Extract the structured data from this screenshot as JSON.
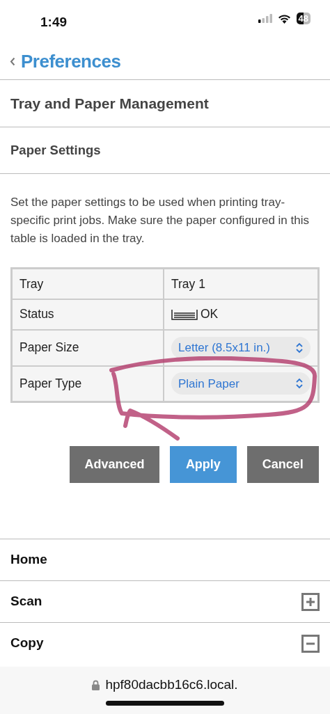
{
  "status_bar": {
    "time": "1:49",
    "battery": "48"
  },
  "header": {
    "back_label": "Preferences"
  },
  "sections": [
    {
      "title": "Tray and Paper Management",
      "kind": "major"
    },
    {
      "title": "Paper Settings",
      "kind": "minor"
    }
  ],
  "description": "Set the paper settings to be used when printing tray-specific print jobs. Make sure the paper configured in this table is loaded in the tray.",
  "table": {
    "rows": [
      {
        "label": "Tray",
        "kind": "text",
        "value": "Tray 1"
      },
      {
        "label": "Status",
        "kind": "status",
        "value": "OK"
      },
      {
        "label": "Paper Size",
        "kind": "select",
        "value": "Letter (8.5x11 in.)"
      },
      {
        "label": "Paper Type",
        "kind": "select",
        "value": "Plain Paper"
      }
    ]
  },
  "buttons": [
    {
      "label": "Advanced",
      "kind": "secondary"
    },
    {
      "label": "Apply",
      "kind": "primary"
    },
    {
      "label": "Cancel",
      "kind": "secondary"
    }
  ],
  "nav": [
    {
      "label": "Home",
      "kind": "link"
    },
    {
      "label": "Scan",
      "kind": "toggle",
      "expanded": false
    },
    {
      "label": "Copy",
      "kind": "toggle",
      "expanded": true
    }
  ],
  "browser_bar": {
    "url": "hpf80dacbb16c6.local."
  }
}
